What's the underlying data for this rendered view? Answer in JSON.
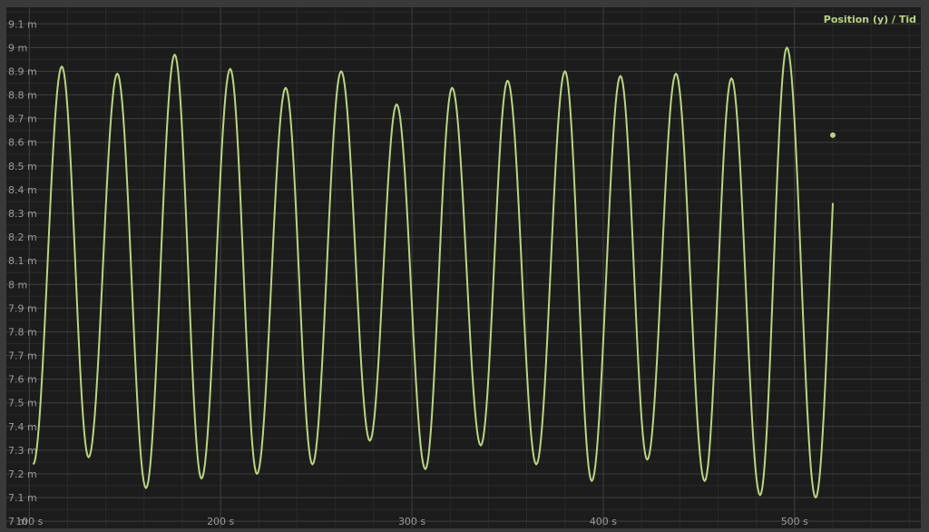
{
  "chart_data": {
    "type": "line",
    "legend_label": "Position (y) / Tid",
    "legend_position": "top-right",
    "grid": true,
    "xlim": [
      88,
      566
    ],
    "ylim": [
      6.97,
      9.17
    ],
    "x_ticks": [
      100,
      200,
      300,
      400,
      500
    ],
    "x_tick_labels": [
      "100 s",
      "200 s",
      "300 s",
      "400 s",
      "500 s"
    ],
    "y_ticks": [
      7.0,
      7.1,
      7.2,
      7.3,
      7.4,
      7.5,
      7.6,
      7.7,
      7.8,
      7.9,
      8.0,
      8.1,
      8.2,
      8.3,
      8.4,
      8.5,
      8.6,
      8.7,
      8.8,
      8.9,
      9.0,
      9.1
    ],
    "y_tick_labels": [
      "7 m",
      "7.1 m",
      "7.2 m",
      "7.3 m",
      "7.4 m",
      "7.5 m",
      "7.6 m",
      "7.7 m",
      "7.8 m",
      "7.9 m",
      "8 m",
      "8.1 m",
      "8.2 m",
      "8.3 m",
      "8.4 m",
      "8.5 m",
      "8.6 m",
      "8.7 m",
      "8.8 m",
      "8.9 m",
      "9 m",
      "9.1 m"
    ],
    "colors": {
      "line": "#b8d77c",
      "grid": "#3d3d3d",
      "background": "#1c1c1c",
      "axis_text": "#9a9a9a"
    },
    "series": [
      {
        "name": "Position (y)",
        "extrema": [
          [
            102,
            7.24
          ],
          [
            117,
            8.92
          ],
          [
            131,
            7.27
          ],
          [
            146,
            8.89
          ],
          [
            161,
            7.14
          ],
          [
            176,
            8.97
          ],
          [
            190,
            7.18
          ],
          [
            205,
            8.91
          ],
          [
            219,
            7.2
          ],
          [
            234,
            8.83
          ],
          [
            248,
            7.24
          ],
          [
            263,
            8.9
          ],
          [
            278,
            7.34
          ],
          [
            292,
            8.76
          ],
          [
            307,
            7.22
          ],
          [
            321,
            8.83
          ],
          [
            336,
            7.32
          ],
          [
            350,
            8.86
          ],
          [
            365,
            7.24
          ],
          [
            380,
            8.9
          ],
          [
            394,
            7.17
          ],
          [
            409,
            8.88
          ],
          [
            423,
            7.26
          ],
          [
            438,
            8.89
          ],
          [
            453,
            7.17
          ],
          [
            467,
            8.87
          ],
          [
            482,
            7.11
          ],
          [
            496,
            9.0
          ],
          [
            511,
            7.1
          ]
        ],
        "end_point": [
          520,
          8.63
        ]
      }
    ]
  }
}
